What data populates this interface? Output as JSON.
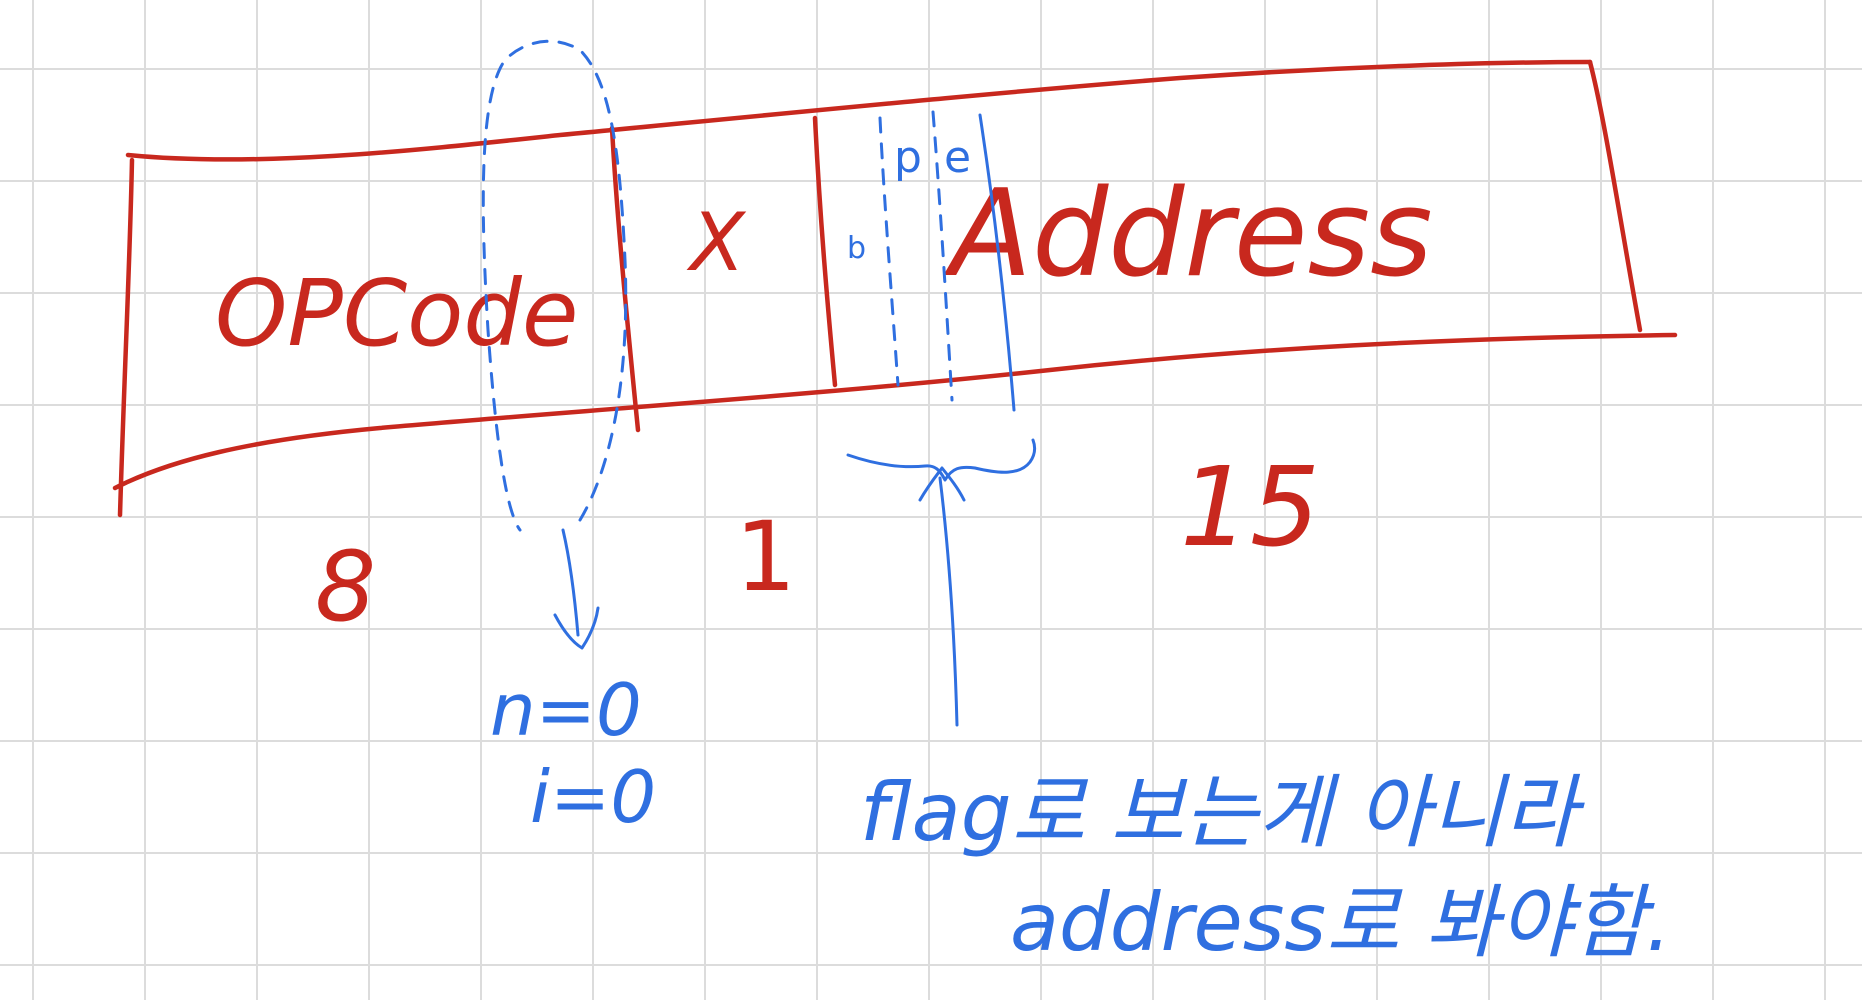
{
  "diagram": {
    "fields": [
      {
        "key": "opcode",
        "label": "OPCode",
        "bits": "8"
      },
      {
        "key": "x",
        "label": "X",
        "bits": "1"
      },
      {
        "key": "address",
        "label": "Address",
        "bits": "15"
      }
    ],
    "flags": {
      "b": "b",
      "p": "p",
      "e": "e"
    },
    "ni_note": {
      "n": "n=0",
      "i": "i=0"
    },
    "note": {
      "line1": "flag로 보는게 아니라",
      "line2": "address로 봐야함."
    },
    "colors": {
      "red": "#c8281e",
      "blue": "#2f6fe0",
      "grid": "#dcdcdc"
    }
  }
}
